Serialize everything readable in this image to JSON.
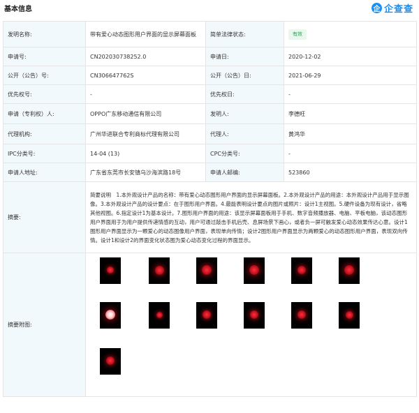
{
  "header": {
    "title": "基本信息",
    "brand_logo": "企",
    "brand_text": "企查查"
  },
  "rows": [
    {
      "l1": "发明名称:",
      "v1": "带有爱心动态图形用户界面的显示屏幕面板",
      "l2": "简单法律状态:",
      "v2": "有效"
    },
    {
      "l1": "申请号:",
      "v1": "CN202030738252.0",
      "l2": "申请日:",
      "v2": "2020-12-02"
    },
    {
      "l1": "公开（公告）号:",
      "v1": "CN306647762S",
      "l2": "公开（公告）日:",
      "v2": "2021-06-29"
    },
    {
      "l1": "优先权号:",
      "v1": "-",
      "l2": "优先权日:",
      "v2": "-"
    },
    {
      "l1": "申请（专利权）人:",
      "v1": "OPPO广东移动通信有限公司",
      "l2": "发明人:",
      "v2": "李德旺"
    },
    {
      "l1": "代理机构:",
      "v1": "广州华进联合专利商标代理有限公司",
      "l2": "代理人:",
      "v2": "黄鸿华"
    },
    {
      "l1": "IPC分类号:",
      "v1": "14-04 (13)",
      "l2": "CPC分类号:",
      "v2": "-"
    },
    {
      "l1": "申请人地址:",
      "v1": "广东省东莞市长安镇乌沙海滨路18号",
      "l2": "申请人邮编:",
      "v2": "523860"
    }
  ],
  "abstract": {
    "label": "摘要:",
    "text": "简要说明　1.本外观设计产品的名称：带有爱心动态图形用户界面的显示屏幕面板。2.本外观设计产品的用途：本外观设计产品用于显示图像。3.本外观设计产品的设计要点：在于图形用户界面。4.最能表明设计要点的图片或照片：设计1主视图。5.硬件设备为现有设计，省略其他视图。6.指定设计1为基本设计。7.图形用户界面的用途：该显示屏幕面板用于手机、数字音频播放器、电脑、平板电脑，该动态图形用户界面用于为用户提供传递情感的互动，用户可通过敲击手机后壳、息屏场景下画心，或者负一屏可触发爱心动态效果传达心意。设计1图形用户界面显示为一颗爱心的动态图像用户界面，表现单向传情；设计2图形用户界面显示为两颗爱心的动态图形用户界面，表现双向传情。设计1和设计2的界面变化状态图为爱心动态变化过程的界面显示。"
  },
  "attachment": {
    "label": "摘要附图:"
  }
}
